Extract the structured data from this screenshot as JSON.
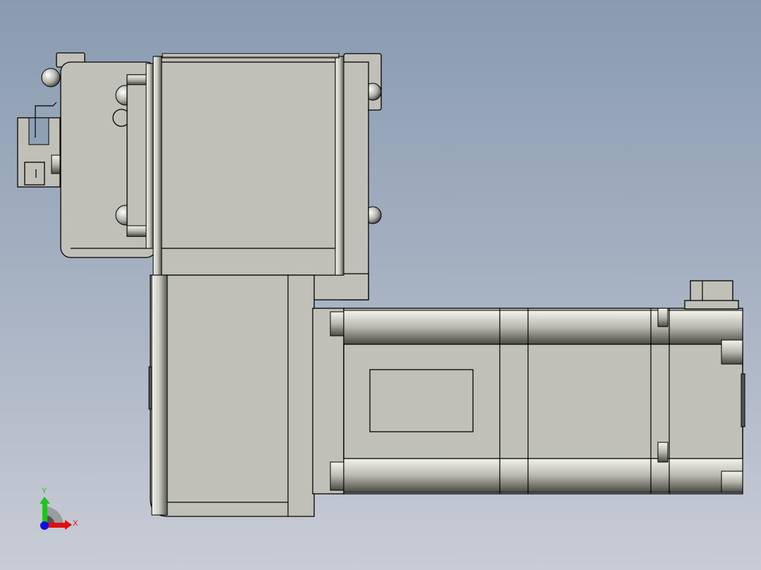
{
  "viewport": {
    "background_top": "#8a9bb0",
    "background_bottom": "#c9ccd6",
    "part_color": "#c0c0b8"
  },
  "model": {
    "components": [
      "mounting-bracket",
      "connector-block",
      "gear-housing",
      "gearbox",
      "servo-motor",
      "motor-connector"
    ]
  },
  "triad": {
    "x_label": "X",
    "y_label": "Y",
    "x_color": "#e01010",
    "y_color": "#20c020",
    "z_color": "#1010e0"
  }
}
